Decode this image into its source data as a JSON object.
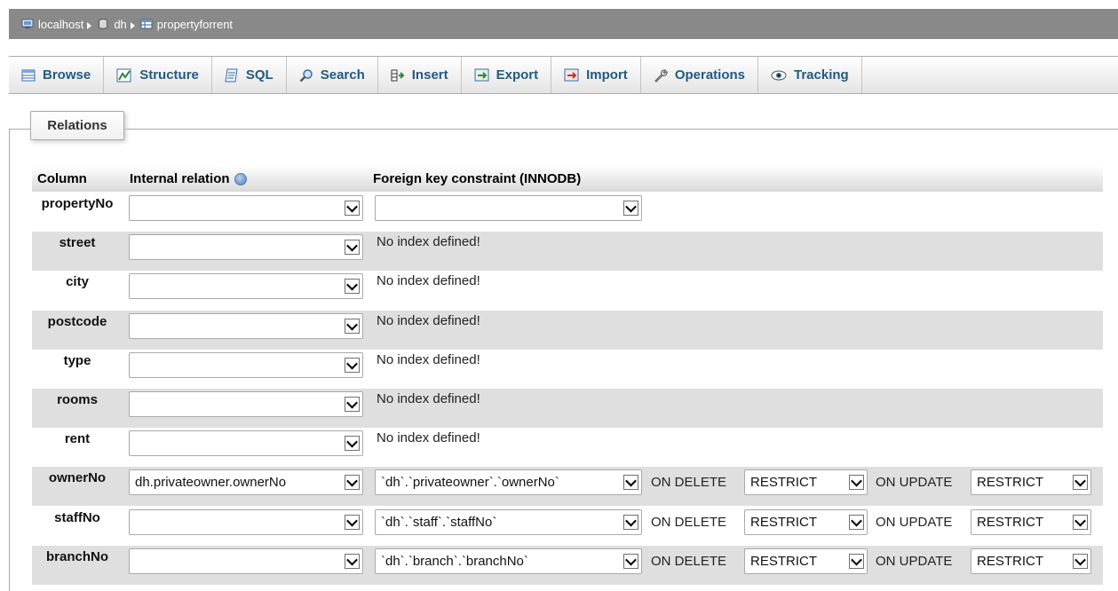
{
  "breadcrumb": {
    "server": "localhost",
    "database": "dh",
    "table": "propertyforrent"
  },
  "tabs": [
    {
      "label": "Browse",
      "icon": "browse-icon"
    },
    {
      "label": "Structure",
      "icon": "structure-icon"
    },
    {
      "label": "SQL",
      "icon": "sql-icon"
    },
    {
      "label": "Search",
      "icon": "search-icon"
    },
    {
      "label": "Insert",
      "icon": "insert-icon"
    },
    {
      "label": "Export",
      "icon": "export-icon"
    },
    {
      "label": "Import",
      "icon": "import-icon"
    },
    {
      "label": "Operations",
      "icon": "operations-icon"
    },
    {
      "label": "Tracking",
      "icon": "tracking-icon"
    }
  ],
  "relations": {
    "legend": "Relations",
    "headers": {
      "column": "Column",
      "internal": "Internal relation",
      "foreign": "Foreign key constraint (INNODB)"
    },
    "no_index_text": "No index defined!",
    "on_delete_label": "ON DELETE",
    "on_update_label": "ON UPDATE",
    "rows": [
      {
        "name": "propertyNo",
        "internal": "",
        "fk": ""
      },
      {
        "name": "street",
        "internal": "",
        "fk": null
      },
      {
        "name": "city",
        "internal": "",
        "fk": null
      },
      {
        "name": "postcode",
        "internal": "",
        "fk": null
      },
      {
        "name": "type",
        "internal": "",
        "fk": null
      },
      {
        "name": "rooms",
        "internal": "",
        "fk": null
      },
      {
        "name": "rent",
        "internal": "",
        "fk": null
      },
      {
        "name": "ownerNo",
        "internal": "dh.privateowner.ownerNo",
        "fk": "`dh`.`privateowner`.`ownerNo`",
        "on_delete": "RESTRICT",
        "on_update": "RESTRICT"
      },
      {
        "name": "staffNo",
        "internal": "",
        "fk": "`dh`.`staff`.`staffNo`",
        "on_delete": "RESTRICT",
        "on_update": "RESTRICT"
      },
      {
        "name": "branchNo",
        "internal": "",
        "fk": "`dh`.`branch`.`branchNo`",
        "on_delete": "RESTRICT",
        "on_update": "RESTRICT"
      }
    ]
  }
}
